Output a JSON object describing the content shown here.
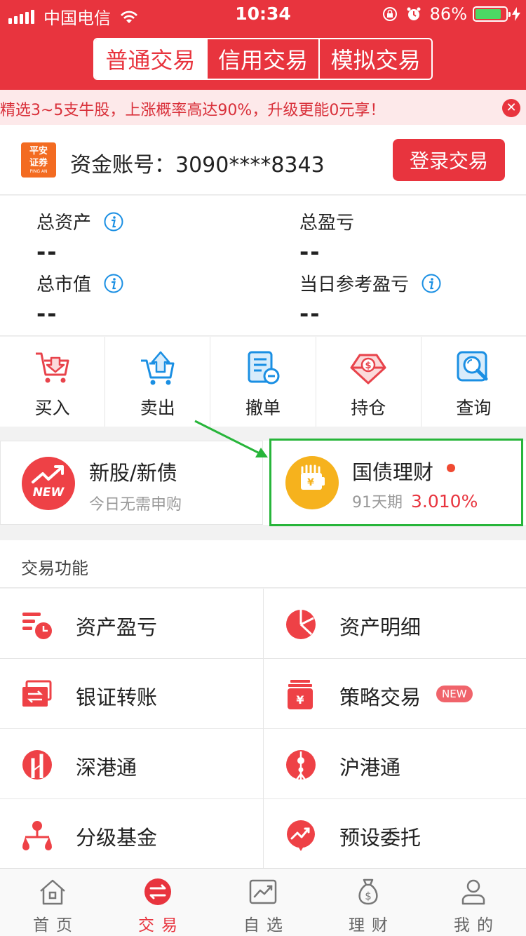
{
  "status_bar": {
    "carrier": "中国电信",
    "time": "10:34",
    "battery_percent": "86%",
    "battery_level": 0.86
  },
  "header": {
    "segments": [
      {
        "label": "普通交易",
        "active": true
      },
      {
        "label": "信用交易",
        "active": false
      },
      {
        "label": "模拟交易",
        "active": false
      }
    ]
  },
  "marquee": {
    "text": "精选3~5支牛股，上涨概率高达90%，升级更能0元享！",
    "close_symbol": "✕"
  },
  "account": {
    "logo_text_line1": "平安",
    "logo_text_line2": "证券",
    "logo_text_en": "PING AN",
    "label": "资金账号：3090****8343",
    "login_button": "登录交易"
  },
  "assets": {
    "total_assets_label": "总资产",
    "total_assets_value": "--",
    "total_pnl_label": "总盈亏",
    "total_pnl_value": "--",
    "market_value_label": "总市值",
    "market_value_value": "--",
    "daily_pnl_label": "当日参考盈亏",
    "daily_pnl_value": "--"
  },
  "actions": [
    {
      "label": "买入",
      "icon": "buy-cart-icon"
    },
    {
      "label": "卖出",
      "icon": "sell-cart-icon"
    },
    {
      "label": "撤单",
      "icon": "cancel-order-icon"
    },
    {
      "label": "持仓",
      "icon": "position-icon"
    },
    {
      "label": "查询",
      "icon": "query-icon"
    }
  ],
  "promos": {
    "ipo": {
      "title": "新股/新债",
      "subtitle": "今日无需申购",
      "badge": "NEW"
    },
    "bond": {
      "title": "国债理财",
      "term": "91天期",
      "rate": "3.010%"
    }
  },
  "functions": {
    "header": "交易功能",
    "items": [
      {
        "label": "资产盈亏",
        "icon": "asset-pnl-icon"
      },
      {
        "label": "资产明细",
        "icon": "asset-detail-icon"
      },
      {
        "label": "银证转账",
        "icon": "bank-transfer-icon"
      },
      {
        "label": "策略交易",
        "icon": "strategy-trade-icon",
        "badge": "NEW"
      },
      {
        "label": "深港通",
        "icon": "shenzhen-hk-connect-icon"
      },
      {
        "label": "沪港通",
        "icon": "shanghai-hk-connect-icon"
      },
      {
        "label": "分级基金",
        "icon": "graded-fund-icon"
      },
      {
        "label": "预设委托",
        "icon": "preset-order-icon"
      }
    ]
  },
  "tabbar": [
    {
      "label": "首页",
      "icon": "home-icon",
      "active": false
    },
    {
      "label": "交易",
      "icon": "trade-icon",
      "active": true
    },
    {
      "label": "自选",
      "icon": "watchlist-icon",
      "active": false
    },
    {
      "label": "理财",
      "icon": "wealth-icon",
      "active": false
    },
    {
      "label": "我的",
      "icon": "profile-icon",
      "active": false
    }
  ],
  "colors": {
    "brand_red": "#e8343e",
    "highlight_green": "#27b53a",
    "bond_orange": "#f6b21d"
  }
}
